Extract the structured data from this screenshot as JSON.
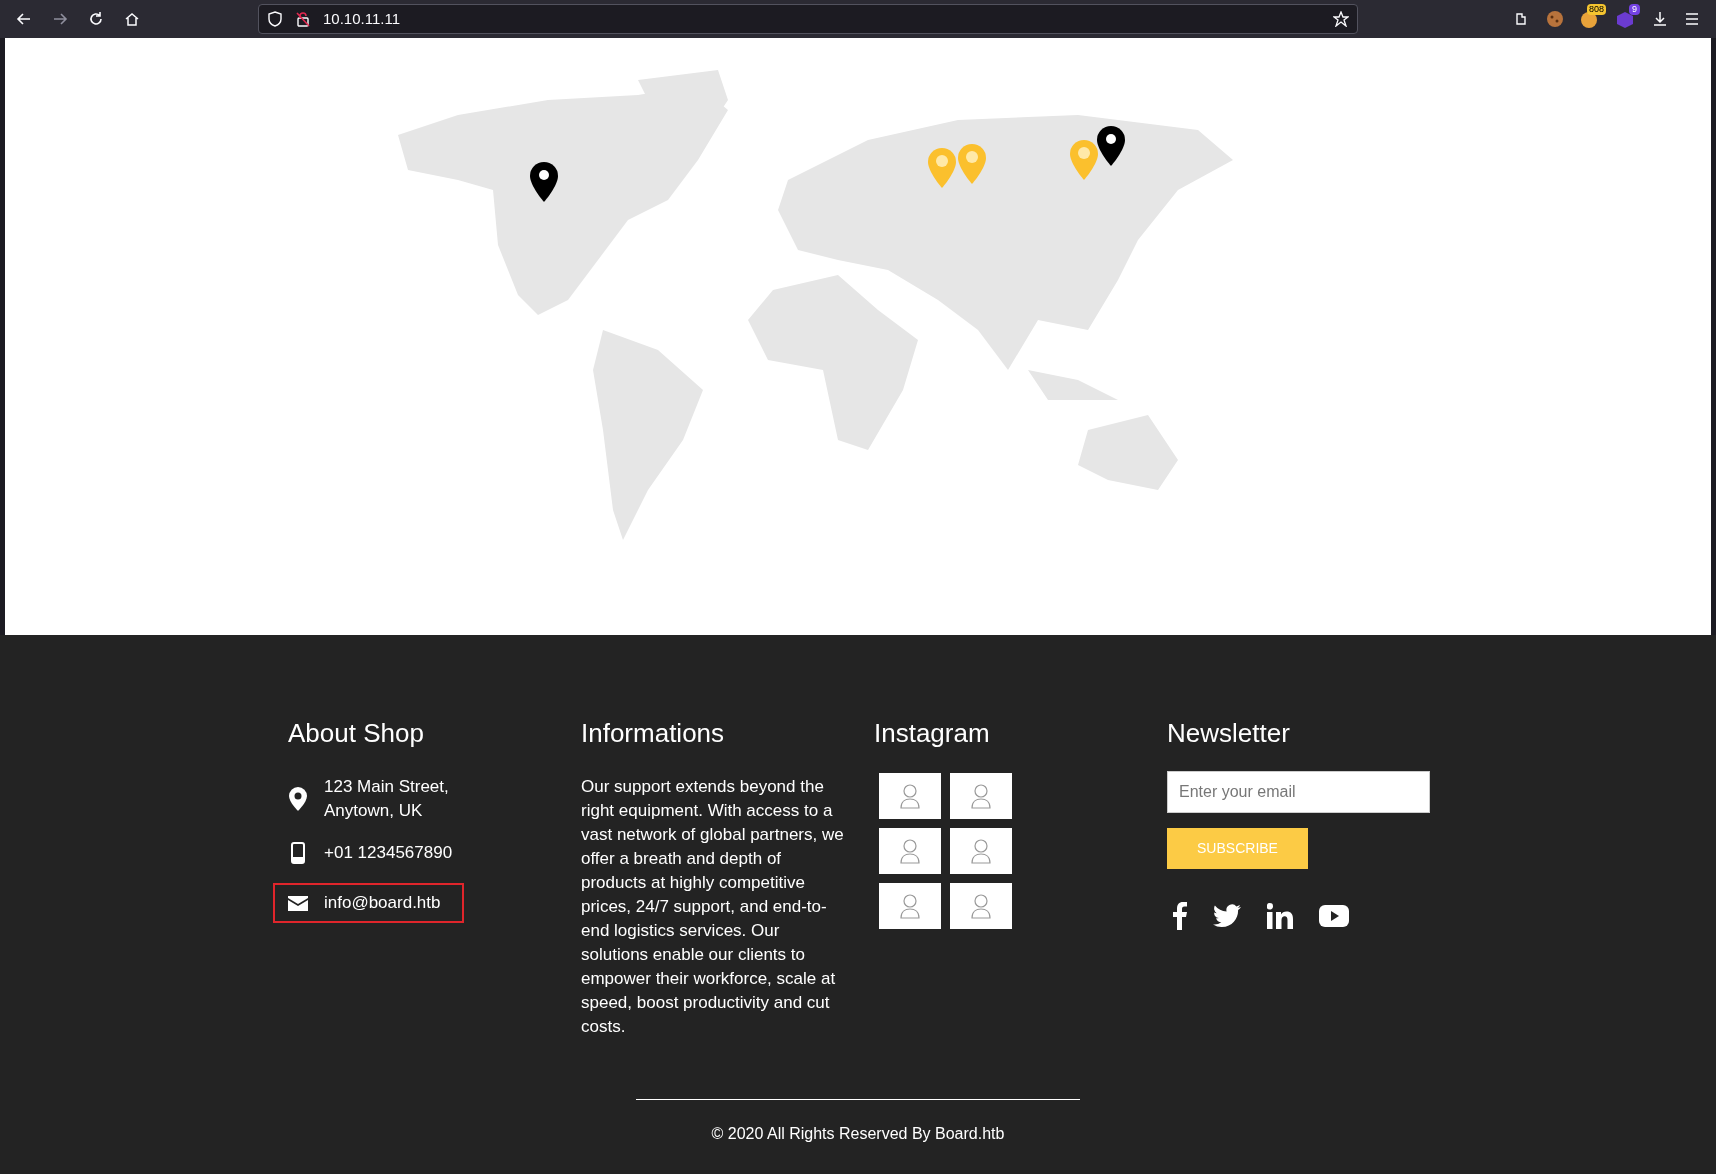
{
  "browser": {
    "url": "10.10.11.11",
    "extension_badges": [
      "808",
      "9"
    ]
  },
  "footer": {
    "about": {
      "title": "About Shop",
      "contacts": [
        {
          "kind": "location",
          "lines": [
            "123 Main Street,",
            "Anytown, UK"
          ],
          "highlighted": false
        },
        {
          "kind": "phone",
          "lines": [
            "+01 1234567890"
          ],
          "highlighted": false
        },
        {
          "kind": "email",
          "lines": [
            "info@board.htb"
          ],
          "highlighted": true
        }
      ]
    },
    "informations": {
      "title": "Informations",
      "text": "Our support extends beyond the right equipment. With access to a vast network of global partners, we offer a breath and depth of products at highly competitive prices, 24/7 support, and end-to-end logistics services. Our solutions enable our clients to empower their workforce, scale at speed, boost productivity and cut costs."
    },
    "instagram": {
      "title": "Instagram"
    },
    "newsletter": {
      "title": "Newsletter",
      "placeholder": "Enter your email",
      "button": "SUBSCRIBE"
    },
    "copyright": "© 2020 All Rights Reserved By Board.htb"
  }
}
